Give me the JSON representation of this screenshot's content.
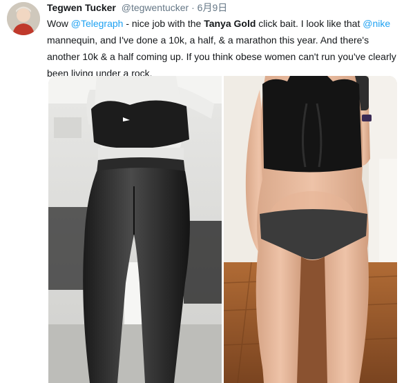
{
  "tweet": {
    "author_name": "Tegwen Tucker",
    "author_handle": "@tegwentucker",
    "separator": "·",
    "date": "6月9日",
    "text_parts": {
      "p1": "Wow ",
      "mention1": "@Telegraph",
      "p2": " - nice job with the ",
      "bold": "Tanya Gold",
      "p3": " click bait. I look like that ",
      "mention2": "@nike",
      "p4": " mannequin, and I've done a 10k, a half, & a marathon this year. And there's another 10k & a half coming up. If you think obese women can't run you've clearly been living under a rock."
    }
  },
  "colors": {
    "link": "#1da1f2",
    "text": "#14171a",
    "muted": "#657786"
  },
  "media": {
    "left_photo": "mannequin in black sports bra and leggings in a store",
    "right_photo": "woman taking mirror selfie in black sports bra and briefs"
  }
}
